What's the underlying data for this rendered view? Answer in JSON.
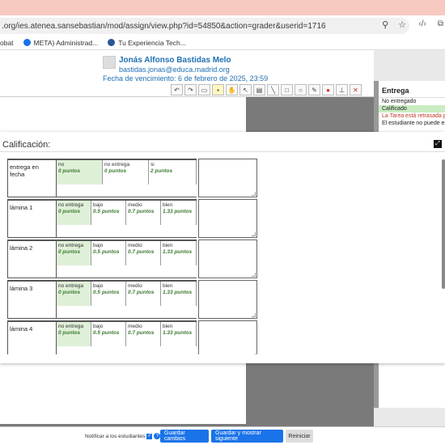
{
  "browser": {
    "url": ".org/ies.atenea.sansebastian/mod/assign/view.php?id=54850&action=grader&userid=1716",
    "bookmarks": [
      "obat",
      "META) Administrad...",
      "Tu Experiencia Tech..."
    ]
  },
  "header": {
    "name": "Jonás Alfonso Bastidas Melo",
    "email": "bastidas.jonas@educa.madrid.org",
    "due": "Fecha de vencimiento: 6 de febrero de 2025, 23:59"
  },
  "submission": {
    "title": "Entrega",
    "status_not_submitted": "No entregado",
    "status_graded": "Calificado",
    "late": "La Tarea está retrasada por: 2 d",
    "cannot_edit": "El estudiante no puede editar"
  },
  "grading": {
    "title": "Calificación:",
    "criteria": [
      {
        "label": "entrega en fecha",
        "levels": [
          {
            "name": "no",
            "points": "0 puntos",
            "selected": true
          },
          {
            "name": "no entrega",
            "points": "0 puntos",
            "selected": false
          },
          {
            "name": "si",
            "points": "2 puntos",
            "selected": false
          }
        ]
      },
      {
        "label": "lámina 1",
        "levels": [
          {
            "name": "no entrega",
            "points": "0 puntos",
            "selected": true
          },
          {
            "name": "bajo",
            "points": "0.5 puntos",
            "selected": false
          },
          {
            "name": "medio",
            "points": "0.7 puntos",
            "selected": false
          },
          {
            "name": "bien",
            "points": "1.33 puntos",
            "selected": false
          }
        ]
      },
      {
        "label": "lámina 2",
        "levels": [
          {
            "name": "no entrega",
            "points": "0 puntos",
            "selected": true
          },
          {
            "name": "bajo",
            "points": "0.5 puntos",
            "selected": false
          },
          {
            "name": "medio",
            "points": "0.7 puntos",
            "selected": false
          },
          {
            "name": "bien",
            "points": "1.33 puntos",
            "selected": false
          }
        ]
      },
      {
        "label": "lámina 3",
        "levels": [
          {
            "name": "no entrega",
            "points": "0 puntos",
            "selected": true
          },
          {
            "name": "bajo",
            "points": "0.5 puntos",
            "selected": false
          },
          {
            "name": "medio",
            "points": "0.7 puntos",
            "selected": false
          },
          {
            "name": "bien",
            "points": "1.33 puntos",
            "selected": false
          }
        ]
      },
      {
        "label": "lámina 4",
        "levels": [
          {
            "name": "no entrega",
            "points": "0 puntos",
            "selected": true
          },
          {
            "name": "bajo",
            "points": "0.5 puntos",
            "selected": false
          },
          {
            "name": "medio",
            "points": "0.7 puntos",
            "selected": false
          },
          {
            "name": "bien",
            "points": "1.33 puntos",
            "selected": false
          }
        ]
      }
    ]
  },
  "footer": {
    "notify": "Notificar a los estudiantes",
    "save": "Guardar cambios",
    "save_next": "Guardar y mostrar siguiente",
    "reset": "Reiniciar"
  }
}
